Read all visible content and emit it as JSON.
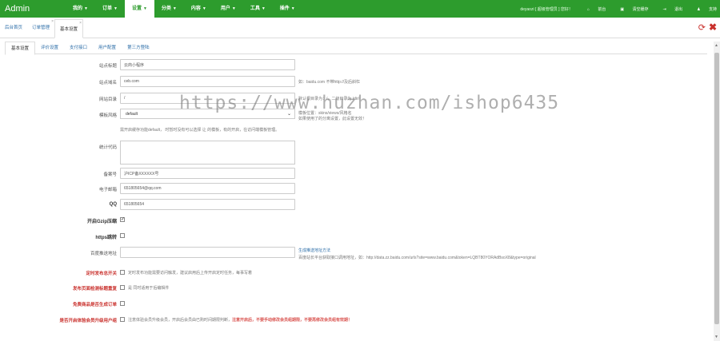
{
  "brand": "Admin",
  "nav": [
    {
      "label": "我的"
    },
    {
      "label": "订单"
    },
    {
      "label": "设置",
      "active": true
    },
    {
      "label": "分类"
    },
    {
      "label": "内容"
    },
    {
      "label": "用户"
    },
    {
      "label": "工具"
    },
    {
      "label": "插件"
    }
  ],
  "topright": {
    "user": "deyaozi [ 超级管理员 ] 您好！",
    "home": "前台",
    "cache": "清空缓存",
    "logout": "退出",
    "support": "支持"
  },
  "pagetabs": [
    {
      "label": "后台首页"
    },
    {
      "label": "订单管理",
      "closable": true
    },
    {
      "label": "基本设置",
      "closable": true,
      "active": true
    }
  ],
  "subtabs": [
    {
      "label": "基本设置",
      "active": true
    },
    {
      "label": "评价设置"
    },
    {
      "label": "支付接口"
    },
    {
      "label": "用户配置"
    },
    {
      "label": "第三方登陆"
    }
  ],
  "form": {
    "site_title": {
      "label": "站点标题",
      "value": "云商小程序"
    },
    "site_domain": {
      "label": "站点域名",
      "value": "ceb.com",
      "hint": "如：baidu.com 不带http://及后斜杠"
    },
    "install_dir": {
      "label": "网站目录",
      "value": "/",
      "hint": "默认根目录为：/，二级目录为 /dir/"
    },
    "template": {
      "label": "模板风格",
      "value": "default",
      "hint1": "模板位置：skins/views/风格名",
      "hint2": "如果使用了的分离设置，此设置无效！"
    },
    "template_note": "需开启缓存功能default，  时暂时没有可以选择 让 的模板，有的开启，在访问端模板管理。",
    "stats_code": {
      "label": "统计代码"
    },
    "icp": {
      "label": "备案号",
      "value": "沪ICP备XXXXXX号"
    },
    "email": {
      "label": "电子邮箱",
      "value": "651805654@qq.com"
    },
    "qq": {
      "label": "QQ",
      "value": "651805654"
    },
    "gzip": {
      "label": "开启Gzip压缩"
    },
    "https": {
      "label": "https跳转"
    },
    "baidu_push": {
      "label": "百度推送地址",
      "hint1": "生成推送地址方法",
      "hint2": "百度站长平台获取接口调用地址，如：http://data.zz.baidu.com/urls?site=www.baidu.com&token=LQBT80YORAdBsoX8&type=original"
    },
    "order_limit": {
      "label": "定时发布总开关",
      "hint": "定时发布功能需要访问触发，建议启用后上传开启定时任务，每事写着"
    },
    "auto_check": {
      "label": "发布页面检测标题重复",
      "hint": "是  同时适用于后编辑件"
    },
    "free_order": {
      "label": "免费商品是否生成订单"
    },
    "mobile": {
      "label": "是否开启体验会员升级用户组",
      "hint_a": "注意体验会员升级会员，开启后会员由已购时间期限判断，",
      "hint_b": "注意开启后，不要手动修改会员组期限，不要再修改会员组有效期！"
    }
  },
  "watermark": "https://www.huzhan.com/ishop6435"
}
